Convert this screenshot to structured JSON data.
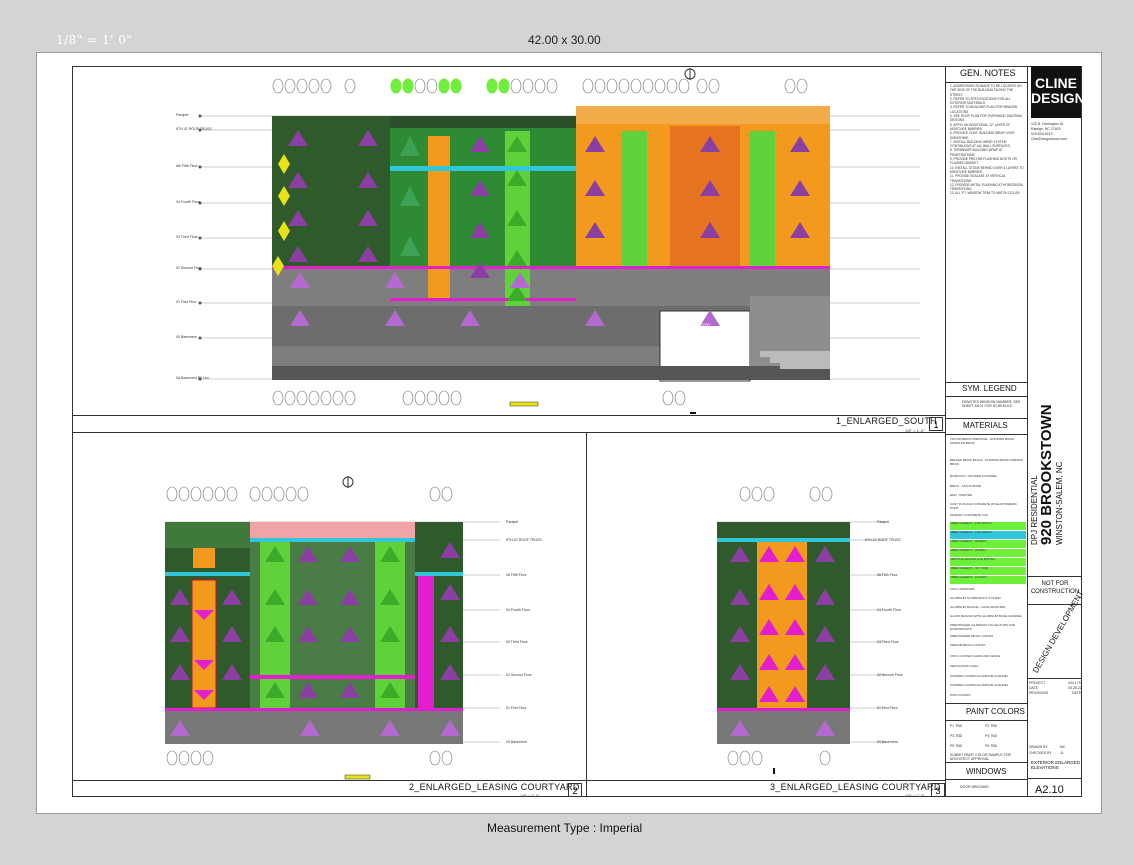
{
  "viewer": {
    "scale_label": "1/8\" = 1' 0\"",
    "sheet_size": "42.00 x 30.00",
    "measurement": "Measurement Type : Imperial"
  },
  "views": {
    "south": {
      "title": "1_ENLARGED_SOUTH",
      "number": "1",
      "scale": "1/8\" = 1'-0\""
    },
    "courtyard_left": {
      "title": "2_ENLARGED_LEASING COURTYARD",
      "number": "2",
      "scale": "1/8\" = 1'-0\""
    },
    "courtyard_right": {
      "title": "3_ENLARGED_LEASING COURTYARD",
      "number": "3",
      "scale": "1/8\" = 1'-0\""
    },
    "auto_entry": "AUTO ENTRY"
  },
  "levels_south": [
    "Parapet",
    "6TH LE ROOF TRUSS",
    "6th Fifth Floor",
    "04 Fourth Floor",
    "03 Third Floor",
    "02 Second Floor",
    "01 First Floor",
    "00 Basement",
    "0A Basement P2 Lev"
  ],
  "levels_courtyard": [
    "Parapet",
    "6TH LE ROOF TRUSS",
    "06 Fifth Floor",
    "04 Fourth Floor",
    "03 Third Floor",
    "02 Second Floor",
    "01 First Floor",
    "00 Basement"
  ],
  "side_panel": {
    "gen_notes_title": "GEN. NOTES",
    "logo_line1": "CLINE",
    "logo_line2": "DESIGN",
    "logo_address": [
      "125 N. Harrington St.",
      "Raleigh, NC 27603",
      "919.833.6413",
      "ClineDesignAssoc.com"
    ],
    "notes": [
      "1. ADDRESSING SIGNAGE TO BE LOCATED ON THE SIDE OF THE BUILDING FACING THE STREET.",
      "2. REFER TO SPECIFICATIONS FOR ALL EXTERIOR MATERIALS.",
      "3. REFER TO BUILDING PLAN FOR WINDOW LOCATIONS.",
      "4. SEE ROOF PLAN FOR OVERHANG DIAGRAM DESIGNS.",
      "5. APPLY AN ADDITIONAL 12\" LAYER OF MOISTURE BARRIER.",
      "6. PROVIDE CONT. BUILDING WRAP OVER SHEATHING.",
      "7. INSTALL BUILDING WRAP SYSTEM CONTINUOUS AT ALL WALL SURFACES.",
      "8. TERMINATE BUILDING WRAP AT PENETRATIONS.",
      "9. PROVIDE PRE-FAB FLASHING BOOTS OR FLASHED BASKET.",
      "10. INSTALL STONE BEHIND OVER 3 LAYERS TO MOISTURE BARRIER.",
      "11. PROVIDE SEALANT AT VERTICAL TRANSITIONS.",
      "12. PROVIDE METAL FLASHING AT HORIZONTAL TRANSITIONS.",
      "13. ALL P.T. WINDOW TRIM TO MATCH COLOR."
    ],
    "sym_legend_title": "SYM. LEGEND",
    "sym_legend_text": "DENOTES WINDOW NUMBER. SEE SHEET A6.01 FOR SCHEDULE.",
    "materials_title": "MATERIALS",
    "materials": [
      "TAYLOR BRICK PRESTIGE - RUNNING BOND MODULAR BRICK",
      "BELDEN BRICK BLACK - RUNNING BOND NORMAN BRICK",
      "ROWLOCK / SOLDIER COURSES",
      "BRICK - STACK BOND",
      "EMU - PAINTED",
      "CAST IN PLACE CONCRETE W/ ELASTOMERIC PAINT",
      "PAVESET CONCRETE CAP",
      "FIBER CEMENT - LAP SIDING",
      "FIBER CEMENT - LAP SIDING",
      "FIBER CEMENT - PANELS",
      "FIBER CEMENT - PANELS",
      "VERTICAL BOARD AND BATTEN",
      "FIBER CEMENT - 3/4\" TRIM",
      "FIBER CEMENT - ACCENT",
      "VINYL WINDOWS",
      "ALUMINUM STOREFRONT SYSTEM",
      "ALUMINUM RAILING - FACE MOUNTED",
      "GLASS RAILING WITH ALUMINUM BASE CHANNEL",
      "PREFINISHED ALUMINUM COLLECTORS AND DOWNSPOUTS",
      "PREFINISHED METAL COPING",
      "PREFAB METAL CANOPY",
      "VINYL COATED CHAIN LINK FENCE",
      "VENTILATION GRILL",
      "POWDER COATED ALUMINUM CHANNEL",
      "POWDER COATED ALUMINUM CHANNEL",
      "PATIO DOORS"
    ],
    "paint_title": "PAINT COLORS",
    "paint": [
      "P1 TBD",
      "P2 TBD",
      "P3 TBD",
      "P4 TBD",
      "P5 TBD",
      "P6 TBD"
    ],
    "paint_note": "SUBMIT PAINT COLOR SAMPLE FOR ARCHITECT APPROVAL",
    "windows_title": "WINDOWS",
    "windows_text": "DOOR BRIDGING",
    "project_line1": "DPJ RESIDENTIAL",
    "project_line2": "920 BROOKSTOWN",
    "project_line3": "WINSTON-SALEM, NC",
    "not_for_construction": "NOT FOR CONSTRUCTION",
    "design_development": "DESIGN DEVELOPMENT",
    "project_no_label": "PROJECT",
    "project_no": "424.176",
    "date_label": "DATE",
    "date": "03.28.22",
    "revisions_label": "REVISIONS",
    "revisions_value": "DATE",
    "drawn_by": "DRAWN BY",
    "drawn_by_value": "MC",
    "checked_by": "CHECKED BY",
    "checked_by_value": "JL",
    "sheet_title": "EXTERIOR ENLARGED ELEVATIONS",
    "sheet_number": "A2.10"
  },
  "colors": {
    "dark_green": "#2e5d2c",
    "bright_green": "#5fd13a",
    "lime": "#9be01c",
    "orange": "#f39a1e",
    "magenta": "#e21ecf",
    "purple": "#8b3fa3",
    "cyan": "#2fc7d9",
    "yellow": "#e7e21a",
    "pink": "#f2a3a8",
    "gray": "#8a8a8a"
  }
}
